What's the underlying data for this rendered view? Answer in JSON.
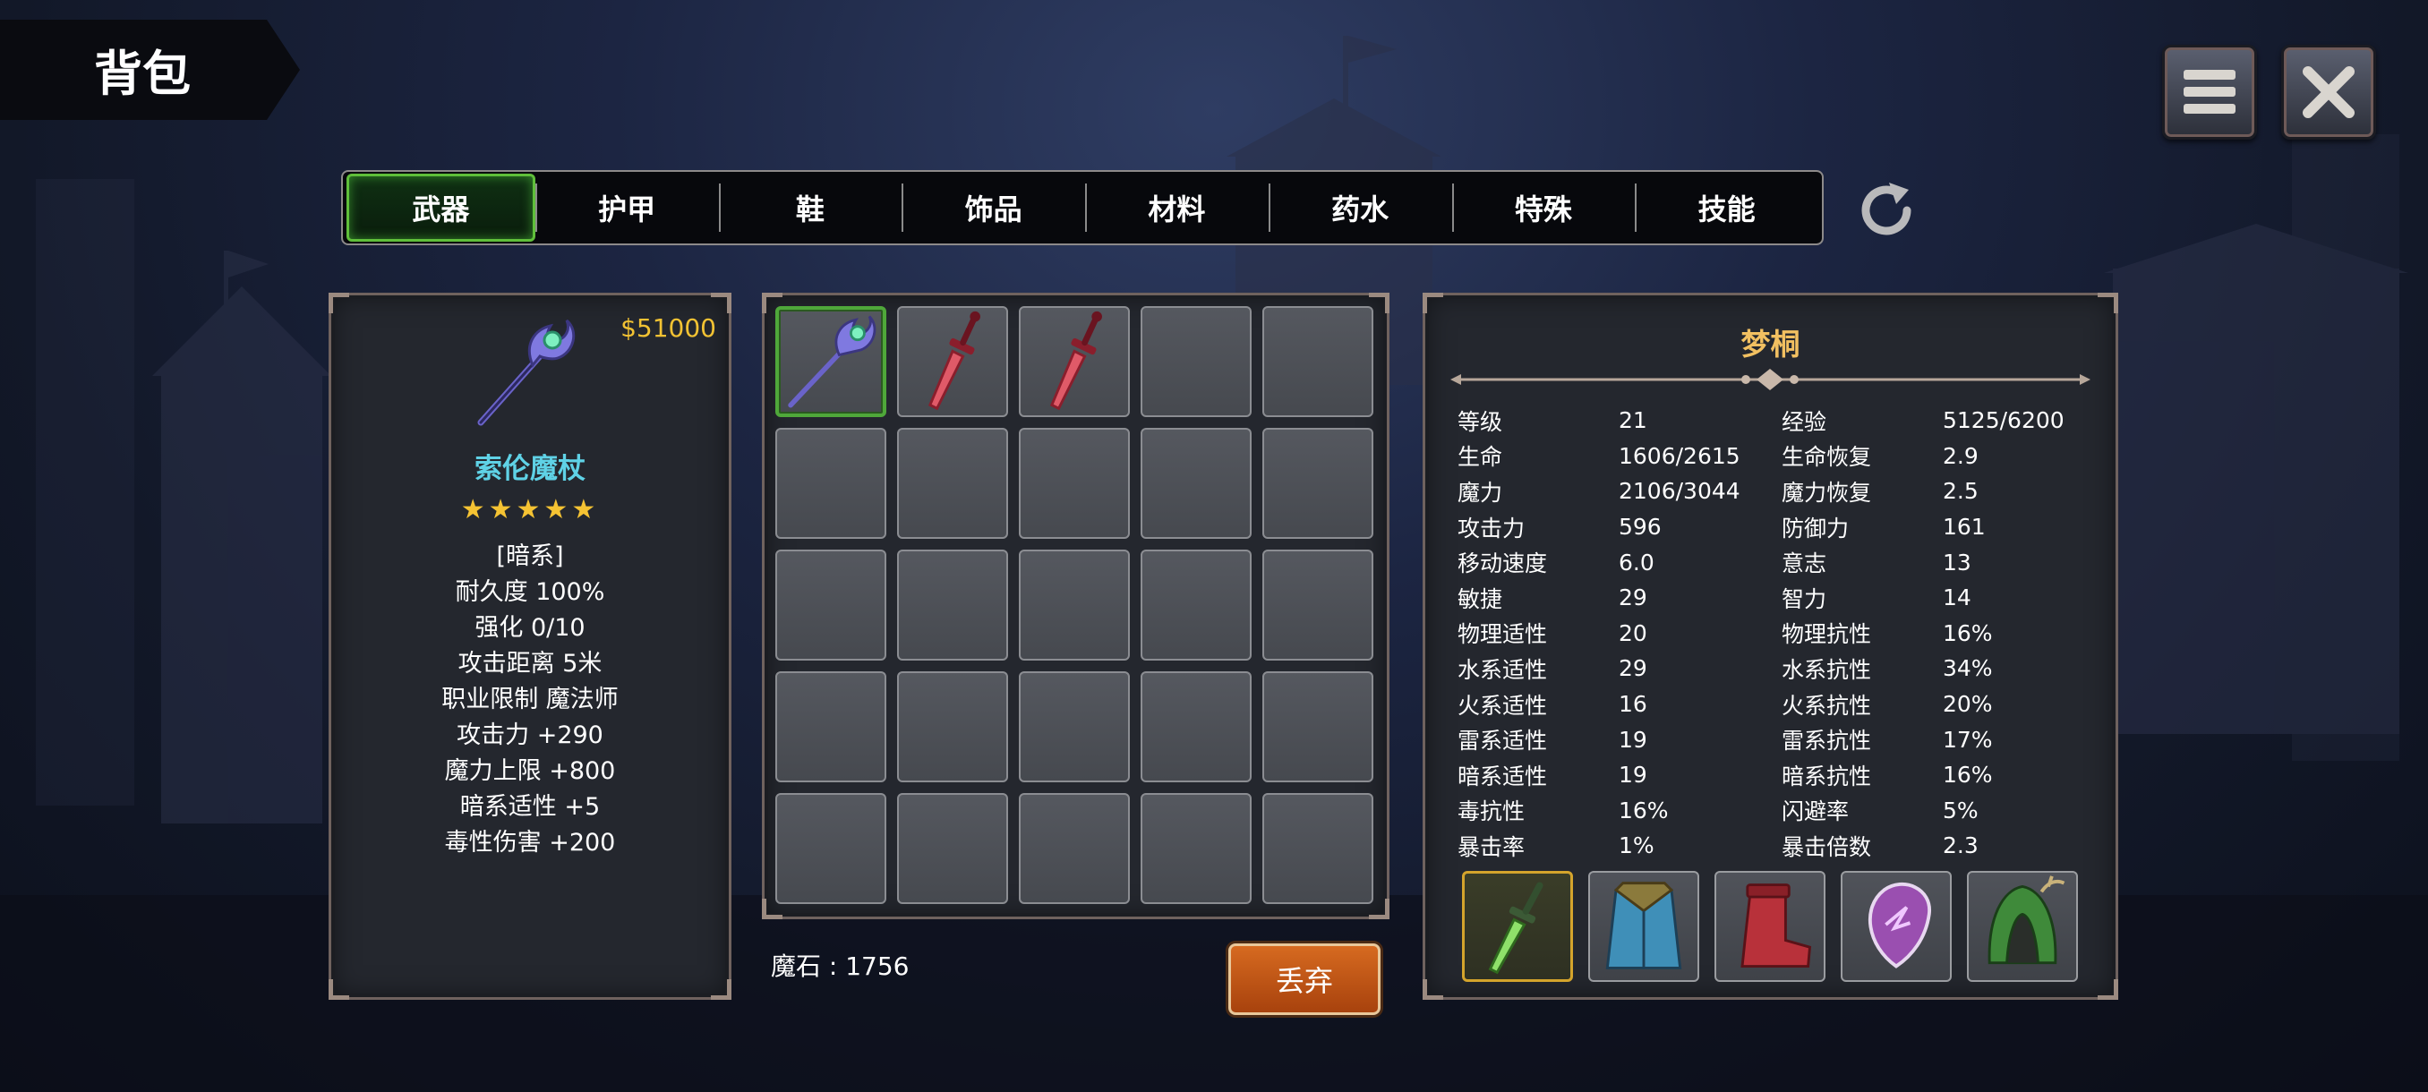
{
  "header": {
    "title": "背包"
  },
  "tabs": [
    {
      "label": "武器",
      "active": true
    },
    {
      "label": "护甲",
      "active": false
    },
    {
      "label": "鞋",
      "active": false
    },
    {
      "label": "饰品",
      "active": false
    },
    {
      "label": "材料",
      "active": false
    },
    {
      "label": "药水",
      "active": false
    },
    {
      "label": "特殊",
      "active": false
    },
    {
      "label": "技能",
      "active": false
    }
  ],
  "item": {
    "price": "$51000",
    "name": "索伦魔杖",
    "stars": "★★★★★",
    "rating": 5,
    "lines": [
      "[暗系]",
      "耐久度 100%",
      "强化 0/10",
      "攻击距离  5米",
      "职业限制  魔法师",
      "攻击力  +290",
      "魔力上限  +800",
      "暗系适性  +5",
      "毒性伤害  +200"
    ]
  },
  "inventory": {
    "slots": [
      "staff-icon",
      "dagger-icon",
      "dagger-icon",
      "",
      "",
      "",
      "",
      "",
      "",
      "",
      "",
      "",
      "",
      "",
      "",
      "",
      "",
      "",
      "",
      "",
      "",
      "",
      "",
      "",
      ""
    ],
    "selected_index": 0,
    "currency_label": "魔石 : 1756",
    "discard_label": "丢弃"
  },
  "character": {
    "name": "梦桐",
    "stats": [
      [
        "等级",
        "21",
        "经验",
        "5125/6200"
      ],
      [
        "生命",
        "1606/2615",
        "生命恢复",
        "2.9"
      ],
      [
        "魔力",
        "2106/3044",
        "魔力恢复",
        "2.5"
      ],
      [
        "攻击力",
        "596",
        "防御力",
        "161"
      ],
      [
        "移动速度",
        "6.0",
        "意志",
        "13"
      ],
      [
        "敏捷",
        "29",
        "智力",
        "14"
      ],
      [
        "物理适性",
        "20",
        "物理抗性",
        "16%"
      ],
      [
        "水系适性",
        "29",
        "水系抗性",
        "34%"
      ],
      [
        "火系适性",
        "16",
        "火系抗性",
        "20%"
      ],
      [
        "雷系适性",
        "19",
        "雷系抗性",
        "17%"
      ],
      [
        "暗系适性",
        "19",
        "暗系抗性",
        "16%"
      ],
      [
        "毒抗性",
        "16%",
        "闪避率",
        "5%"
      ],
      [
        "暴击率",
        "1%",
        "暴击倍数",
        "2.3"
      ]
    ],
    "equipment": [
      "green-dagger-icon",
      "blue-robe-icon",
      "red-boots-icon",
      "purple-amulet-icon",
      "green-helmet-icon"
    ]
  },
  "colors": {
    "accent_green": "#5fbf3a",
    "item_name": "#5fd2e6",
    "price": "#f2c233",
    "char_name": "#f2c061",
    "discard": "#c8561a"
  }
}
